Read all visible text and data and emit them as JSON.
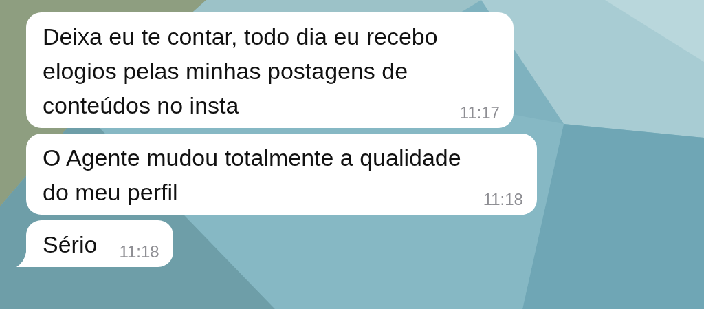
{
  "messages": [
    {
      "text": "Deixa eu te contar, todo dia eu recebo\nelogios pelas minhas postagens de\nconteúdos no insta",
      "time": "11:17",
      "tail": false
    },
    {
      "text": "O Agente mudou totalmente a qualidade\ndo meu perfil",
      "time": "11:18",
      "tail": false
    },
    {
      "text": "Sério",
      "time": "11:18",
      "tail": true
    }
  ]
}
